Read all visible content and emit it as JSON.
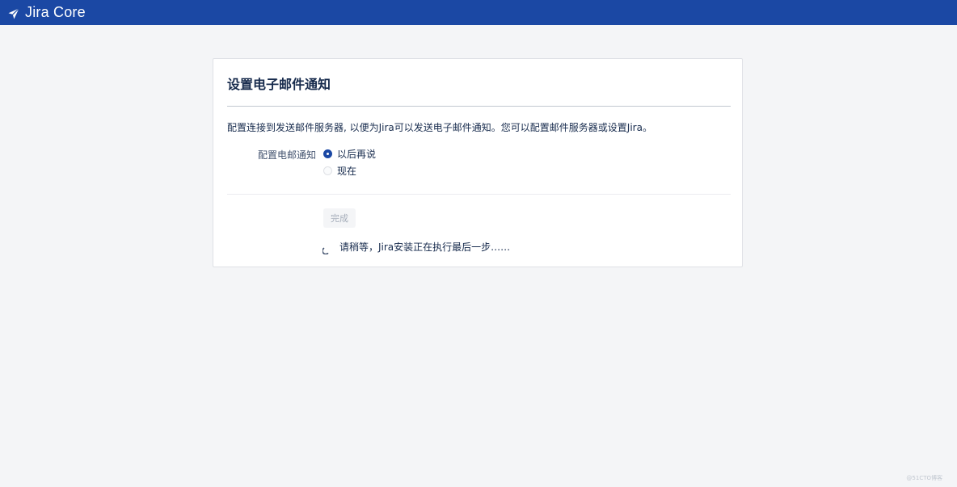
{
  "header": {
    "product_name": "Jira Core",
    "background_color": "#1b48a4",
    "logo_icon": "jira-arrow-icon"
  },
  "setup": {
    "title": "设置电子邮件通知",
    "description": "配置连接到发送邮件服务器, 以便为Jira可以发送电子邮件通知。您可以配置邮件服务器或设置Jira。",
    "field_label": "配置电邮通知",
    "options": [
      {
        "label": "以后再说",
        "checked": true
      },
      {
        "label": "现在",
        "checked": false
      }
    ],
    "finish_button": "完成",
    "loading_text": "请稍等，Jira安装正在执行最后一步……",
    "spinner_icon": "loading-spinner-icon"
  },
  "watermark": "@51CTO博客"
}
